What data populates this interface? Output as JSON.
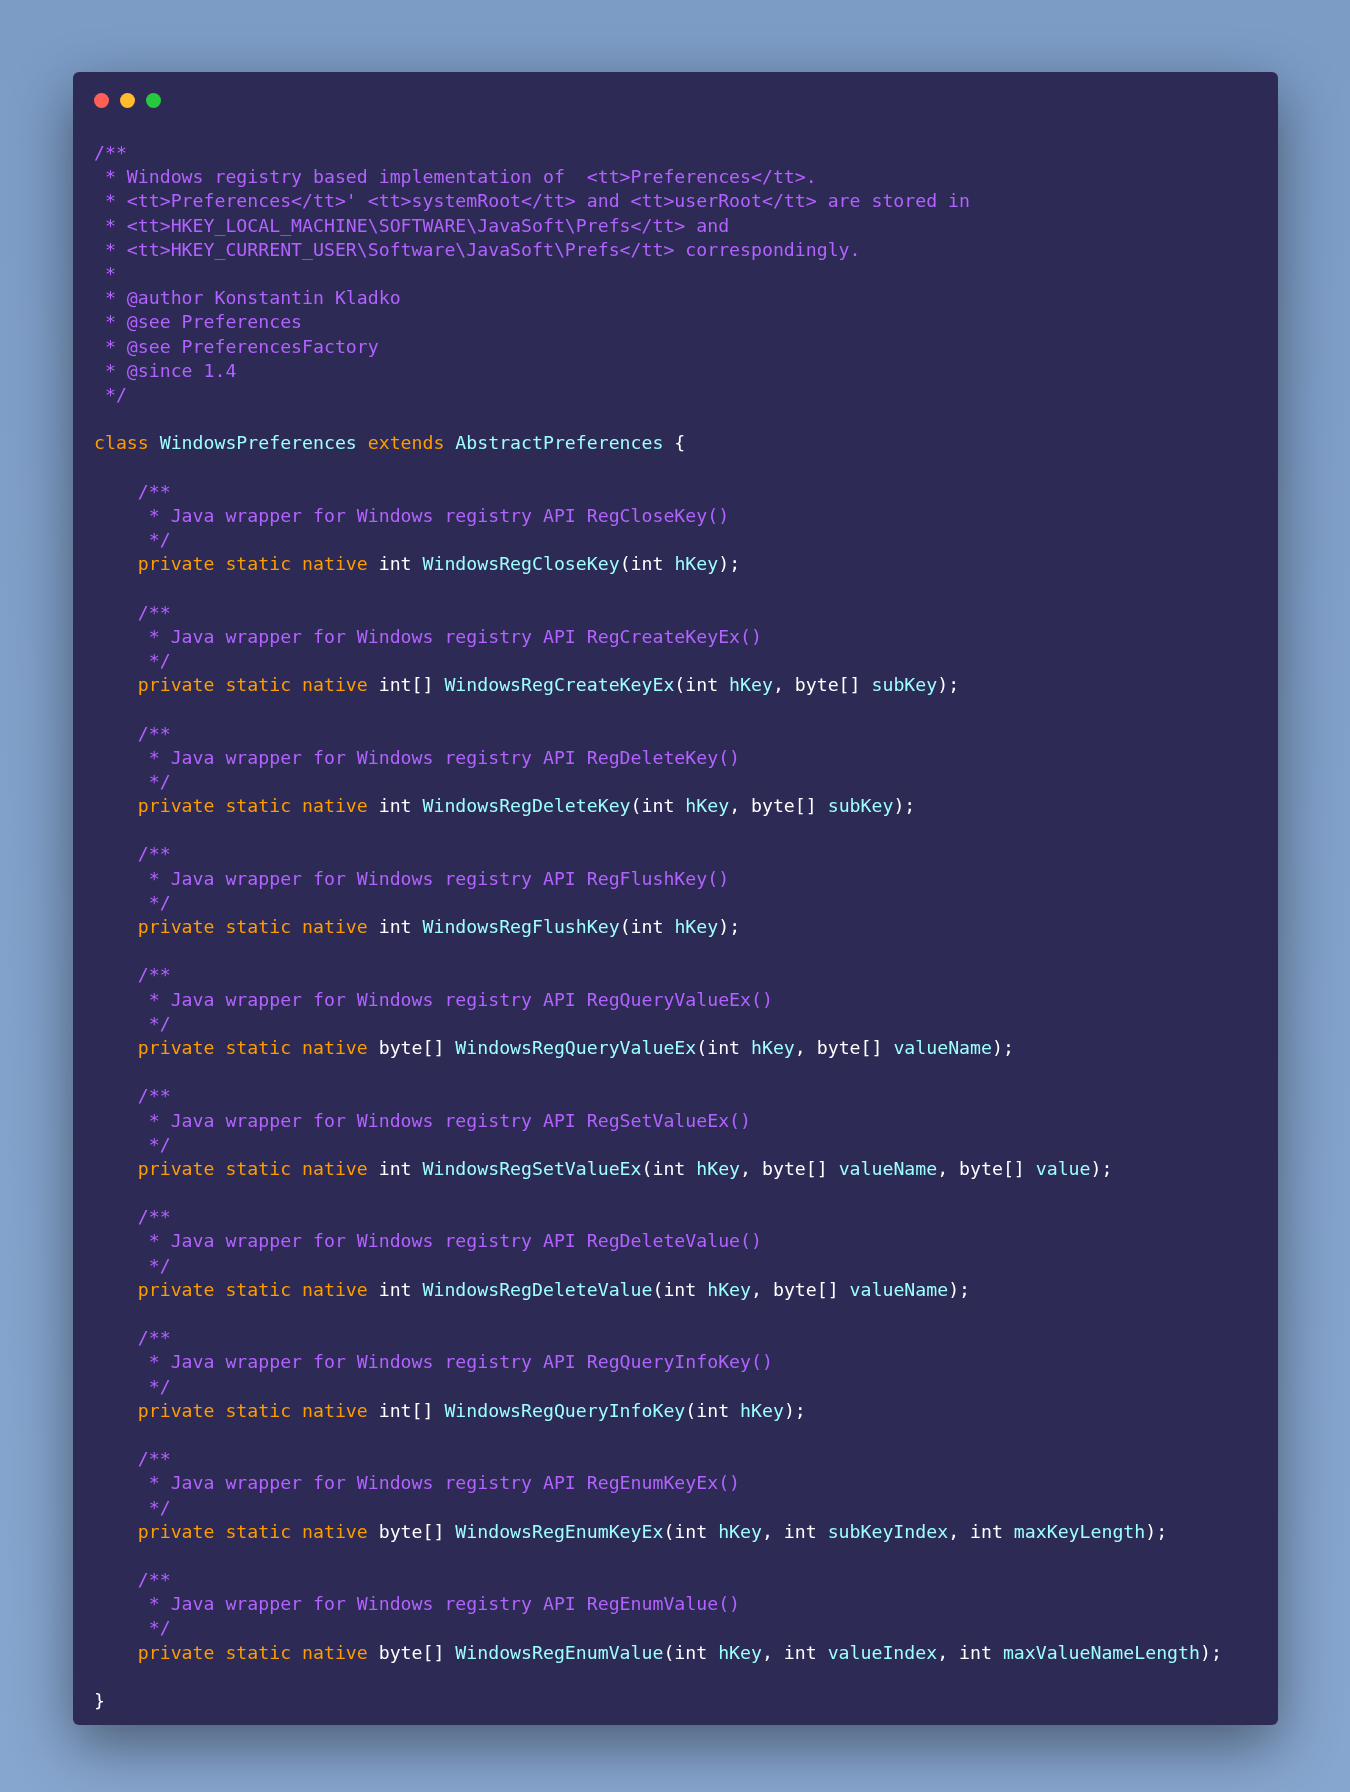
{
  "window": {
    "controls": [
      {
        "color": "#ff5f56"
      },
      {
        "color": "#ffbd2e"
      },
      {
        "color": "#27c93f"
      }
    ]
  },
  "lines": [
    {
      "kind": "code",
      "tokens": [
        {
          "kind": "comment",
          "text": "/**"
        }
      ]
    },
    {
      "kind": "code",
      "tokens": [
        {
          "kind": "comment",
          "text": " * Windows registry based implementation of  <tt>Preferences</tt>."
        }
      ]
    },
    {
      "kind": "code",
      "tokens": [
        {
          "kind": "comment",
          "text": " * <tt>Preferences</tt>' <tt>systemRoot</tt> and <tt>userRoot</tt> are stored in"
        }
      ]
    },
    {
      "kind": "code",
      "tokens": [
        {
          "kind": "comment",
          "text": " * <tt>HKEY_LOCAL_MACHINE\\SOFTWARE\\JavaSoft\\Prefs</tt> and"
        }
      ]
    },
    {
      "kind": "code",
      "tokens": [
        {
          "kind": "comment",
          "text": " * <tt>HKEY_CURRENT_USER\\Software\\JavaSoft\\Prefs</tt> correspondingly."
        }
      ]
    },
    {
      "kind": "code",
      "tokens": [
        {
          "kind": "comment",
          "text": " *"
        }
      ]
    },
    {
      "kind": "code",
      "tokens": [
        {
          "kind": "comment",
          "text": " * @author Konstantin Kladko"
        }
      ]
    },
    {
      "kind": "code",
      "tokens": [
        {
          "kind": "comment",
          "text": " * @see Preferences"
        }
      ]
    },
    {
      "kind": "code",
      "tokens": [
        {
          "kind": "comment",
          "text": " * @see PreferencesFactory"
        }
      ]
    },
    {
      "kind": "code",
      "tokens": [
        {
          "kind": "comment",
          "text": " * @since 1.4"
        }
      ]
    },
    {
      "kind": "code",
      "tokens": [
        {
          "kind": "comment",
          "text": " */"
        }
      ]
    },
    {
      "kind": "blank"
    },
    {
      "kind": "code",
      "tokens": [
        {
          "kind": "keyword",
          "text": "class "
        },
        {
          "kind": "name",
          "text": "WindowsPreferences "
        },
        {
          "kind": "keyword",
          "text": "extends "
        },
        {
          "kind": "name",
          "text": "AbstractPreferences "
        },
        {
          "kind": "plain",
          "text": "{"
        }
      ]
    },
    {
      "kind": "blank"
    },
    {
      "kind": "code",
      "tokens": [
        {
          "kind": "comment",
          "text": "    /**"
        }
      ]
    },
    {
      "kind": "code",
      "tokens": [
        {
          "kind": "comment",
          "text": "     * Java wrapper for Windows registry API RegCloseKey()"
        }
      ]
    },
    {
      "kind": "code",
      "tokens": [
        {
          "kind": "comment",
          "text": "     */"
        }
      ]
    },
    {
      "kind": "code",
      "tokens": [
        {
          "kind": "keyword",
          "text": "    private static native "
        },
        {
          "kind": "plain",
          "text": "int "
        },
        {
          "kind": "name",
          "text": "WindowsRegCloseKey"
        },
        {
          "kind": "plain",
          "text": "(int "
        },
        {
          "kind": "name",
          "text": "hKey"
        },
        {
          "kind": "plain",
          "text": ");"
        }
      ]
    },
    {
      "kind": "blank"
    },
    {
      "kind": "code",
      "tokens": [
        {
          "kind": "comment",
          "text": "    /**"
        }
      ]
    },
    {
      "kind": "code",
      "tokens": [
        {
          "kind": "comment",
          "text": "     * Java wrapper for Windows registry API RegCreateKeyEx()"
        }
      ]
    },
    {
      "kind": "code",
      "tokens": [
        {
          "kind": "comment",
          "text": "     */"
        }
      ]
    },
    {
      "kind": "code",
      "tokens": [
        {
          "kind": "keyword",
          "text": "    private static native "
        },
        {
          "kind": "plain",
          "text": "int[] "
        },
        {
          "kind": "name",
          "text": "WindowsRegCreateKeyEx"
        },
        {
          "kind": "plain",
          "text": "(int "
        },
        {
          "kind": "name",
          "text": "hKey"
        },
        {
          "kind": "plain",
          "text": ", byte[] "
        },
        {
          "kind": "name",
          "text": "subKey"
        },
        {
          "kind": "plain",
          "text": ");"
        }
      ]
    },
    {
      "kind": "blank"
    },
    {
      "kind": "code",
      "tokens": [
        {
          "kind": "comment",
          "text": "    /**"
        }
      ]
    },
    {
      "kind": "code",
      "tokens": [
        {
          "kind": "comment",
          "text": "     * Java wrapper for Windows registry API RegDeleteKey()"
        }
      ]
    },
    {
      "kind": "code",
      "tokens": [
        {
          "kind": "comment",
          "text": "     */"
        }
      ]
    },
    {
      "kind": "code",
      "tokens": [
        {
          "kind": "keyword",
          "text": "    private static native "
        },
        {
          "kind": "plain",
          "text": "int "
        },
        {
          "kind": "name",
          "text": "WindowsRegDeleteKey"
        },
        {
          "kind": "plain",
          "text": "(int "
        },
        {
          "kind": "name",
          "text": "hKey"
        },
        {
          "kind": "plain",
          "text": ", byte[] "
        },
        {
          "kind": "name",
          "text": "subKey"
        },
        {
          "kind": "plain",
          "text": ");"
        }
      ]
    },
    {
      "kind": "blank"
    },
    {
      "kind": "code",
      "tokens": [
        {
          "kind": "comment",
          "text": "    /**"
        }
      ]
    },
    {
      "kind": "code",
      "tokens": [
        {
          "kind": "comment",
          "text": "     * Java wrapper for Windows registry API RegFlushKey()"
        }
      ]
    },
    {
      "kind": "code",
      "tokens": [
        {
          "kind": "comment",
          "text": "     */"
        }
      ]
    },
    {
      "kind": "code",
      "tokens": [
        {
          "kind": "keyword",
          "text": "    private static native "
        },
        {
          "kind": "plain",
          "text": "int "
        },
        {
          "kind": "name",
          "text": "WindowsRegFlushKey"
        },
        {
          "kind": "plain",
          "text": "(int "
        },
        {
          "kind": "name",
          "text": "hKey"
        },
        {
          "kind": "plain",
          "text": ");"
        }
      ]
    },
    {
      "kind": "blank"
    },
    {
      "kind": "code",
      "tokens": [
        {
          "kind": "comment",
          "text": "    /**"
        }
      ]
    },
    {
      "kind": "code",
      "tokens": [
        {
          "kind": "comment",
          "text": "     * Java wrapper for Windows registry API RegQueryValueEx()"
        }
      ]
    },
    {
      "kind": "code",
      "tokens": [
        {
          "kind": "comment",
          "text": "     */"
        }
      ]
    },
    {
      "kind": "code",
      "tokens": [
        {
          "kind": "keyword",
          "text": "    private static native "
        },
        {
          "kind": "plain",
          "text": "byte[] "
        },
        {
          "kind": "name",
          "text": "WindowsRegQueryValueEx"
        },
        {
          "kind": "plain",
          "text": "(int "
        },
        {
          "kind": "name",
          "text": "hKey"
        },
        {
          "kind": "plain",
          "text": ", byte[] "
        },
        {
          "kind": "name",
          "text": "valueName"
        },
        {
          "kind": "plain",
          "text": ");"
        }
      ]
    },
    {
      "kind": "blank"
    },
    {
      "kind": "code",
      "tokens": [
        {
          "kind": "comment",
          "text": "    /**"
        }
      ]
    },
    {
      "kind": "code",
      "tokens": [
        {
          "kind": "comment",
          "text": "     * Java wrapper for Windows registry API RegSetValueEx()"
        }
      ]
    },
    {
      "kind": "code",
      "tokens": [
        {
          "kind": "comment",
          "text": "     */"
        }
      ]
    },
    {
      "kind": "code",
      "tokens": [
        {
          "kind": "keyword",
          "text": "    private static native "
        },
        {
          "kind": "plain",
          "text": "int "
        },
        {
          "kind": "name",
          "text": "WindowsRegSetValueEx"
        },
        {
          "kind": "plain",
          "text": "(int "
        },
        {
          "kind": "name",
          "text": "hKey"
        },
        {
          "kind": "plain",
          "text": ", byte[] "
        },
        {
          "kind": "name",
          "text": "valueName"
        },
        {
          "kind": "plain",
          "text": ", byte[] "
        },
        {
          "kind": "name",
          "text": "value"
        },
        {
          "kind": "plain",
          "text": ");"
        }
      ]
    },
    {
      "kind": "blank"
    },
    {
      "kind": "code",
      "tokens": [
        {
          "kind": "comment",
          "text": "    /**"
        }
      ]
    },
    {
      "kind": "code",
      "tokens": [
        {
          "kind": "comment",
          "text": "     * Java wrapper for Windows registry API RegDeleteValue()"
        }
      ]
    },
    {
      "kind": "code",
      "tokens": [
        {
          "kind": "comment",
          "text": "     */"
        }
      ]
    },
    {
      "kind": "code",
      "tokens": [
        {
          "kind": "keyword",
          "text": "    private static native "
        },
        {
          "kind": "plain",
          "text": "int "
        },
        {
          "kind": "name",
          "text": "WindowsRegDeleteValue"
        },
        {
          "kind": "plain",
          "text": "(int "
        },
        {
          "kind": "name",
          "text": "hKey"
        },
        {
          "kind": "plain",
          "text": ", byte[] "
        },
        {
          "kind": "name",
          "text": "valueName"
        },
        {
          "kind": "plain",
          "text": ");"
        }
      ]
    },
    {
      "kind": "blank"
    },
    {
      "kind": "code",
      "tokens": [
        {
          "kind": "comment",
          "text": "    /**"
        }
      ]
    },
    {
      "kind": "code",
      "tokens": [
        {
          "kind": "comment",
          "text": "     * Java wrapper for Windows registry API RegQueryInfoKey()"
        }
      ]
    },
    {
      "kind": "code",
      "tokens": [
        {
          "kind": "comment",
          "text": "     */"
        }
      ]
    },
    {
      "kind": "code",
      "tokens": [
        {
          "kind": "keyword",
          "text": "    private static native "
        },
        {
          "kind": "plain",
          "text": "int[] "
        },
        {
          "kind": "name",
          "text": "WindowsRegQueryInfoKey"
        },
        {
          "kind": "plain",
          "text": "(int "
        },
        {
          "kind": "name",
          "text": "hKey"
        },
        {
          "kind": "plain",
          "text": ");"
        }
      ]
    },
    {
      "kind": "blank"
    },
    {
      "kind": "code",
      "tokens": [
        {
          "kind": "comment",
          "text": "    /**"
        }
      ]
    },
    {
      "kind": "code",
      "tokens": [
        {
          "kind": "comment",
          "text": "     * Java wrapper for Windows registry API RegEnumKeyEx()"
        }
      ]
    },
    {
      "kind": "code",
      "tokens": [
        {
          "kind": "comment",
          "text": "     */"
        }
      ]
    },
    {
      "kind": "code",
      "tokens": [
        {
          "kind": "keyword",
          "text": "    private static native "
        },
        {
          "kind": "plain",
          "text": "byte[] "
        },
        {
          "kind": "name",
          "text": "WindowsRegEnumKeyEx"
        },
        {
          "kind": "plain",
          "text": "(int "
        },
        {
          "kind": "name",
          "text": "hKey"
        },
        {
          "kind": "plain",
          "text": ", int "
        },
        {
          "kind": "name",
          "text": "subKeyIndex"
        },
        {
          "kind": "plain",
          "text": ", int "
        },
        {
          "kind": "name",
          "text": "maxKeyLength"
        },
        {
          "kind": "plain",
          "text": ");"
        }
      ]
    },
    {
      "kind": "blank"
    },
    {
      "kind": "code",
      "tokens": [
        {
          "kind": "comment",
          "text": "    /**"
        }
      ]
    },
    {
      "kind": "code",
      "tokens": [
        {
          "kind": "comment",
          "text": "     * Java wrapper for Windows registry API RegEnumValue()"
        }
      ]
    },
    {
      "kind": "code",
      "tokens": [
        {
          "kind": "comment",
          "text": "     */"
        }
      ]
    },
    {
      "kind": "code",
      "tokens": [
        {
          "kind": "keyword",
          "text": "    private static native "
        },
        {
          "kind": "plain",
          "text": "byte[] "
        },
        {
          "kind": "name",
          "text": "WindowsRegEnumValue"
        },
        {
          "kind": "plain",
          "text": "(int "
        },
        {
          "kind": "name",
          "text": "hKey"
        },
        {
          "kind": "plain",
          "text": ", int "
        },
        {
          "kind": "name",
          "text": "valueIndex"
        },
        {
          "kind": "plain",
          "text": ", int "
        },
        {
          "kind": "name",
          "text": "maxValueNameLength"
        },
        {
          "kind": "plain",
          "text": ");"
        }
      ]
    },
    {
      "kind": "blank"
    },
    {
      "kind": "code",
      "tokens": [
        {
          "kind": "plain",
          "text": "}"
        }
      ]
    }
  ]
}
